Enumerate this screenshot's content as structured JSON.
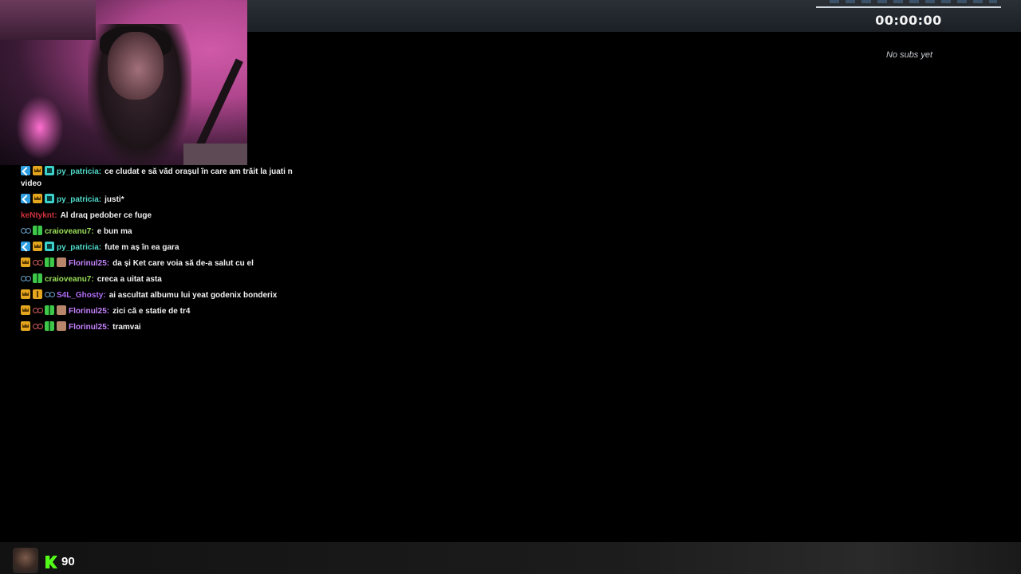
{
  "timer": {
    "value": "00:00:00"
  },
  "subs_panel": {
    "empty_text": "No subs yet"
  },
  "chat": {
    "messages": [
      {
        "user": "py_patricia:",
        "text": "ce cludat e să văd orașul în care am trăit la juati n video"
      },
      {
        "user": "py_patricia:",
        "text": "justi*"
      },
      {
        "user": "keNtyknt:",
        "text": "Al draq pedober ce fuge"
      },
      {
        "user": "craioveanu7:",
        "text": "e bun ma"
      },
      {
        "user": "py_patricia:",
        "text": "fute m aș în ea gara"
      },
      {
        "user": "Florinul25:",
        "text": "da și Ket care voia să de-a salut cu el"
      },
      {
        "user": "craioveanu7:",
        "text": "creca a uitat asta"
      },
      {
        "user": "S4L_Ghosty:",
        "text": "ai ascultat albumu lui yeat godenix bonderix"
      },
      {
        "user": "Florinul25:",
        "text": "zici că e statie de tr4"
      },
      {
        "user": "Florinul25:",
        "text": "tramvai"
      }
    ]
  },
  "footer": {
    "viewer_count": "90"
  },
  "colors": {
    "kick_green": "#53fc18",
    "username_teal": "#4fd8c8",
    "username_red": "#d0313b",
    "username_green": "#9adf5a",
    "username_purple": "#b06cf5"
  },
  "icons": [
    "kick-logo-icon",
    "mod-badge-icon",
    "crown-badge-icon",
    "sub-badge-icon",
    "glasses-badge-icon",
    "gift-badge-icon",
    "bits-badge-icon"
  ]
}
